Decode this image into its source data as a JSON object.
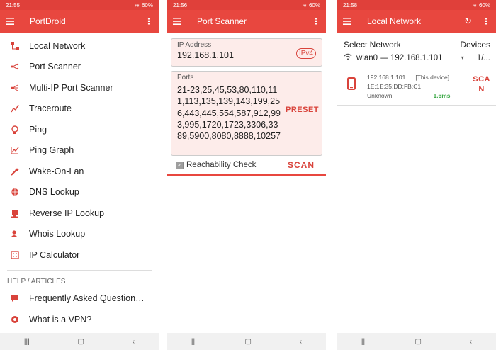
{
  "phone1": {
    "status_time": "21:55",
    "status_right": "60%",
    "title": "PortDroid",
    "menu_items": [
      {
        "label": "Local Network",
        "icon": "local-network-icon"
      },
      {
        "label": "Port Scanner",
        "icon": "port-scanner-icon"
      },
      {
        "label": "Multi-IP Port Scanner",
        "icon": "multi-ip-icon"
      },
      {
        "label": "Traceroute",
        "icon": "traceroute-icon"
      },
      {
        "label": "Ping",
        "icon": "ping-icon"
      },
      {
        "label": "Ping Graph",
        "icon": "ping-graph-icon"
      },
      {
        "label": "Wake-On-Lan",
        "icon": "wake-on-lan-icon"
      },
      {
        "label": "DNS Lookup",
        "icon": "dns-icon"
      },
      {
        "label": "Reverse IP Lookup",
        "icon": "reverse-ip-icon"
      },
      {
        "label": "Whois Lookup",
        "icon": "whois-icon"
      },
      {
        "label": "IP Calculator",
        "icon": "calculator-icon"
      }
    ],
    "section_header": "HELP / ARTICLES",
    "help_items": [
      {
        "label": "Frequently Asked Question…",
        "icon": "faq-icon"
      },
      {
        "label": "What is a VPN?",
        "icon": "vpn-icon"
      }
    ]
  },
  "phone2": {
    "status_time": "21:56",
    "status_right": "60%",
    "title": "Port Scanner",
    "ip_label": "IP Address",
    "ip_value": "192.168.1.101",
    "ipv4_badge": "IPv4",
    "ports_label": "Ports",
    "ports_value": "21-23,25,45,53,80,110,111,113,135,139,143,199,256,443,445,554,587,912,993,995,1720,1723,3306,3389,5900,8080,8888,10257",
    "preset_label": "PRESET",
    "reachability_label": "Reachability Check",
    "scan_label": "SCAN"
  },
  "phone3": {
    "status_time": "21:58",
    "status_right": "60%",
    "title": "Local Network",
    "select_network_label": "Select Network",
    "devices_label": "Devices",
    "devices_count": "1/...",
    "network_value": "wlan0 — 192.168.1.101",
    "device": {
      "ip": "192.168.1.101",
      "tag": "[This device]",
      "mac": "1E:1E:35:DD:FB:C1",
      "vendor": "Unknown",
      "latency": "1.6ms"
    },
    "scan_line1": "SCA",
    "scan_line2": "N"
  },
  "colors": {
    "accent": "#e8473f",
    "latency": "#3aa845"
  }
}
